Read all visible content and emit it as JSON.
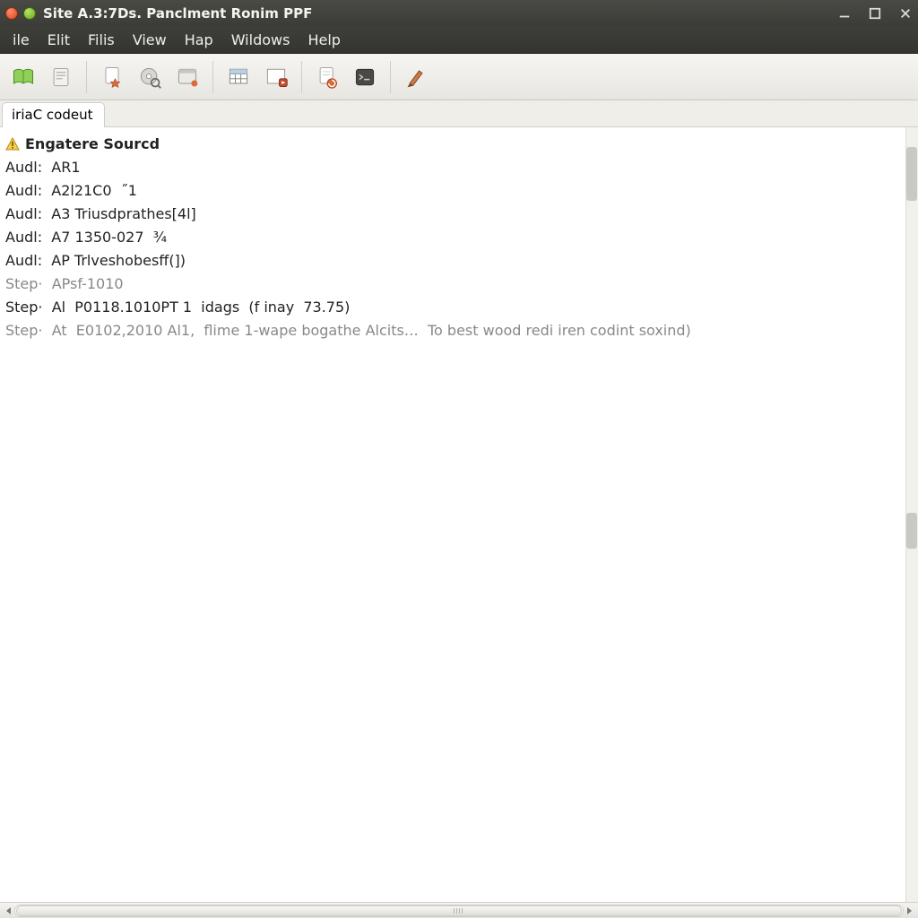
{
  "window": {
    "title": "Site A.3:7Ds. Panclment Ronim PPF"
  },
  "menu": {
    "items": [
      "ile",
      "Elit",
      "Filis",
      "View",
      "Hap",
      "Wildows",
      "Help"
    ]
  },
  "toolbar": {
    "icons": [
      "open-book-icon",
      "document-icon",
      "page-star-icon",
      "disc-search-icon",
      "window-icon",
      "table-icon",
      "gear-icon",
      "page-record-icon",
      "terminal-icon",
      "brush-icon"
    ]
  },
  "tab": {
    "label": "iriaC codeut"
  },
  "log": {
    "heading": "Engatere Sourcd",
    "lines": [
      {
        "dim": false,
        "text": "Audl:  AR1"
      },
      {
        "dim": false,
        "text": "Audl:  A2l21C0  ˝1"
      },
      {
        "dim": false,
        "text": "Audl:  A3 Triusdprathes[4l]"
      },
      {
        "dim": false,
        "text": "Audl:  A7 1350-027  ¾"
      },
      {
        "dim": false,
        "text": "Audl:  AP Trlveshobesff(])"
      },
      {
        "dim": true,
        "text": "Step·  APsf-1010"
      },
      {
        "dim": false,
        "text": "Step·  Al  P0118.1010PT 1  idags  (f inay  73.75)"
      },
      {
        "dim": true,
        "text": "Step·  At  E0102,2010 Al1,  flime 1-wape bogathe Alcits…  To best wood redi iren codint soxind)"
      }
    ]
  }
}
